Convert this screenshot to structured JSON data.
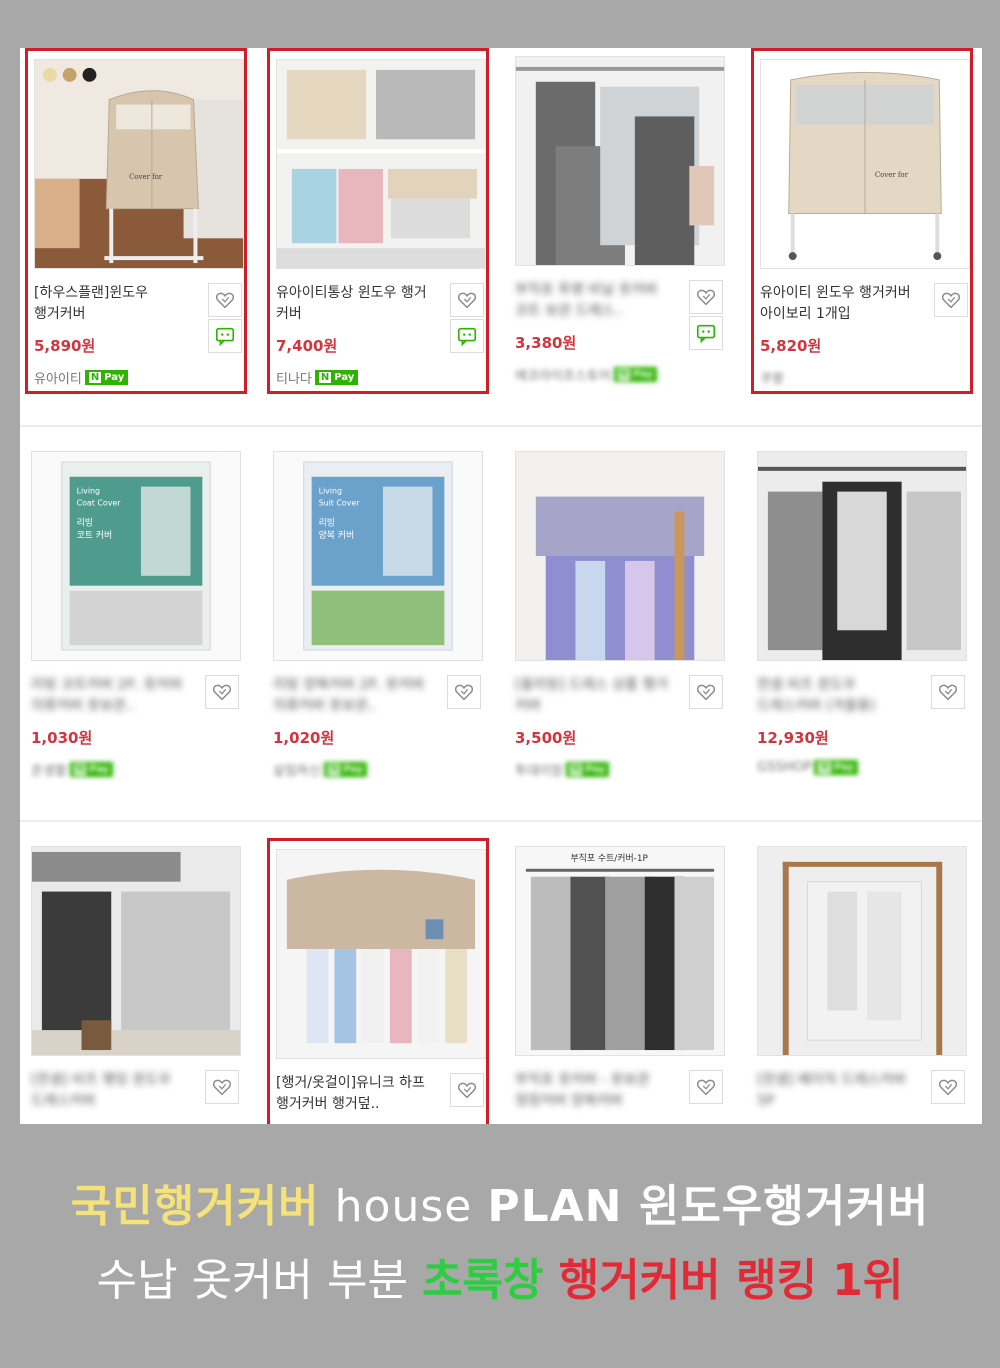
{
  "products": [
    [
      {
        "title": "[하우스플랜]윈도우 행거커버",
        "price": "5,890원",
        "seller": "유아이티",
        "npay": true,
        "highlighted": true,
        "talk": true,
        "blurred": false
      },
      {
        "title": "유아이티통상 윈도우 행거 커버",
        "price": "7,400원",
        "seller": "티나다",
        "npay": true,
        "highlighted": true,
        "talk": true,
        "blurred": false
      },
      {
        "title": "부직포 투명 비닐 옷커버 코트 보관 드레스..",
        "price": "3,380원",
        "seller": "에코라이프스토어",
        "npay": true,
        "highlighted": false,
        "talk": true,
        "blurred": true
      },
      {
        "title": "유아이티 윈도우 행거커버 아이보리 1개입",
        "price": "5,820원",
        "seller": "쿠팡",
        "npay": false,
        "highlighted": true,
        "talk": false,
        "blurred": false
      }
    ],
    [
      {
        "title": "리빙 코트커버 2P, 옷커버 의류커버 옷보관..",
        "price": "1,030원",
        "seller": "온생활",
        "npay": true,
        "highlighted": false,
        "talk": false,
        "blurred": true
      },
      {
        "title": "리빙 양복커버 2P, 옷커버 의류커버 옷보관..",
        "price": "1,020원",
        "seller": "살림하신",
        "npay": true,
        "highlighted": false,
        "talk": false,
        "blurred": true
      },
      {
        "title": "[올리빙] 드레스 상품 행거 커버",
        "price": "3,500원",
        "seller": "투데이맘",
        "npay": true,
        "highlighted": false,
        "talk": false,
        "blurred": true
      },
      {
        "title": "한샘 비츠 윈도우 드레스커버 (겨울용)",
        "price": "12,930원",
        "seller": "GSSHOP",
        "npay": true,
        "highlighted": false,
        "talk": false,
        "blurred": true
      }
    ],
    [
      {
        "title": "[한샘] 비츠 행잉 윈도우 드레스커버",
        "price": "",
        "seller": "",
        "npay": false,
        "highlighted": false,
        "talk": false,
        "blurred": true
      },
      {
        "title": "[행거/옷걸이]유니크 하프 행거커버 행거덮..",
        "price": "",
        "seller": "",
        "npay": false,
        "highlighted": true,
        "talk": false,
        "blurred": false
      },
      {
        "title": "부직포 옷커버 - 옷보관 정장커버 양복커버",
        "price": "",
        "seller": "",
        "npay": false,
        "highlighted": false,
        "talk": false,
        "blurred": true
      },
      {
        "title": "[한샘] 베이직 드레스커버 5P",
        "price": "",
        "seller": "",
        "npay": false,
        "highlighted": false,
        "talk": false,
        "blurred": true
      }
    ]
  ],
  "npay_label": "Pay",
  "npay_mark": "N",
  "image_texts": {
    "cover_for": "Cover for",
    "living_coat_1": "Living",
    "living_coat_2": "Coat Cover",
    "living_coat_3": "리빙",
    "living_coat_4": "코트 커버",
    "living_suit_1": "Living",
    "living_suit_2": "Suit Cover",
    "living_suit_3": "리빙",
    "living_suit_4": "양복 커버",
    "suit_cover_caption": "부직포 수트/커버-1P"
  },
  "banner": {
    "line1_part1": "국민행거커버",
    "line1_part2": " house ",
    "line1_part3": "PLAN",
    "line1_part4": " 윈도우행거커버",
    "line2_part1": "수납 옷커버 부분 ",
    "line2_part2": "초록창",
    "line2_part3": " 행거커버 랭킹 1위"
  },
  "colors": {
    "highlight_border": "#d01d2a",
    "price_red": "#d6333c",
    "npay_green": "#2db400",
    "banner_yellow": "#f6e27a",
    "banner_green": "#2ecc40",
    "banner_red": "#e02b36",
    "background_gray": "#a8a8a8"
  }
}
